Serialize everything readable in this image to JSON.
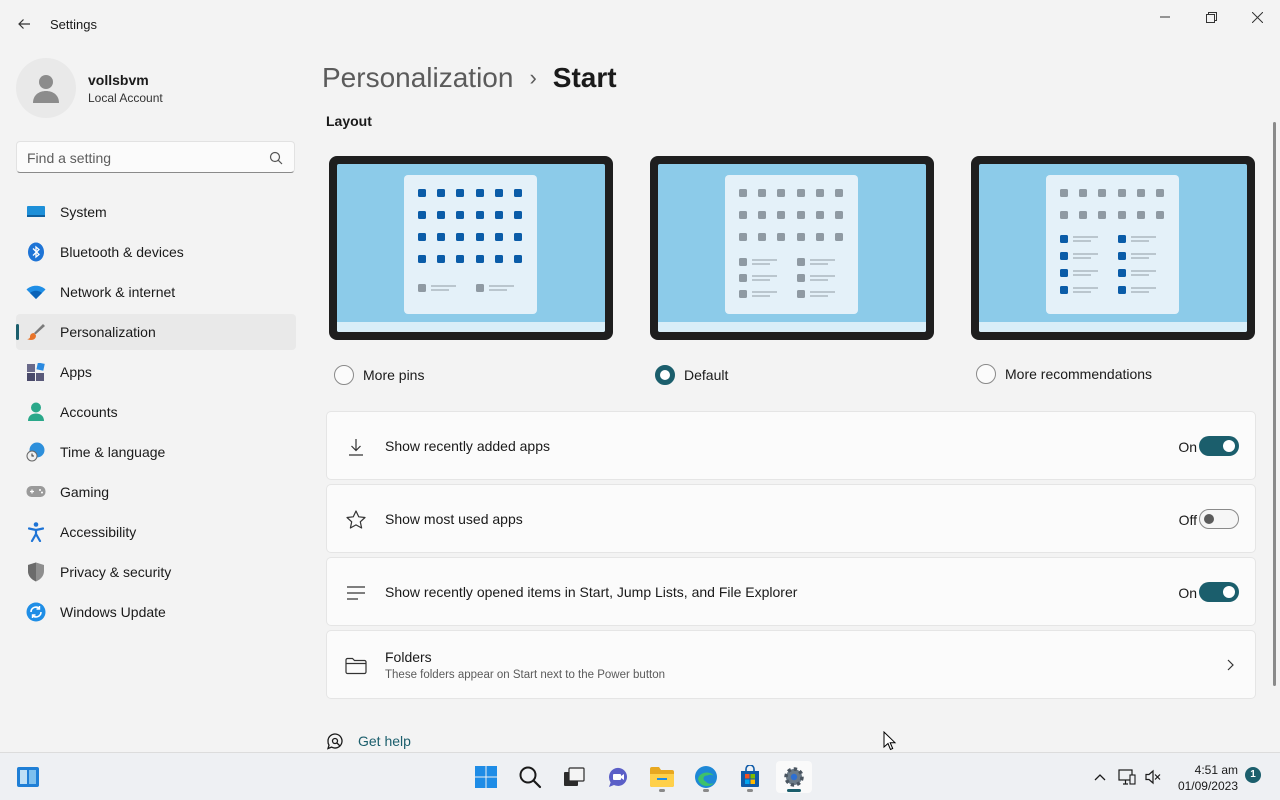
{
  "window": {
    "app_title": "Settings",
    "icons": {
      "back": "back-arrow-icon",
      "minimize": "minimize-icon",
      "maximize": "restore-icon",
      "close": "close-icon"
    }
  },
  "profile": {
    "name": "vollsbvm",
    "account_type": "Local Account"
  },
  "search": {
    "placeholder": "Find a setting",
    "value": ""
  },
  "sidebar": {
    "items": [
      {
        "label": "System",
        "icon": "system-icon",
        "active": false
      },
      {
        "label": "Bluetooth & devices",
        "icon": "bluetooth-icon",
        "active": false
      },
      {
        "label": "Network & internet",
        "icon": "wifi-icon",
        "active": false
      },
      {
        "label": "Personalization",
        "icon": "brush-icon",
        "active": true
      },
      {
        "label": "Apps",
        "icon": "apps-icon",
        "active": false
      },
      {
        "label": "Accounts",
        "icon": "accounts-icon",
        "active": false
      },
      {
        "label": "Time & language",
        "icon": "globe-clock-icon",
        "active": false
      },
      {
        "label": "Gaming",
        "icon": "gamepad-icon",
        "active": false
      },
      {
        "label": "Accessibility",
        "icon": "accessibility-icon",
        "active": false
      },
      {
        "label": "Privacy & security",
        "icon": "shield-icon",
        "active": false
      },
      {
        "label": "Windows Update",
        "icon": "update-icon",
        "active": false
      }
    ]
  },
  "breadcrumb": {
    "parent": "Personalization",
    "separator": "›",
    "current": "Start"
  },
  "layout": {
    "title": "Layout",
    "options": [
      {
        "label": "More pins",
        "selected": false
      },
      {
        "label": "Default",
        "selected": true
      },
      {
        "label": "More recommendations",
        "selected": false
      }
    ]
  },
  "settings": [
    {
      "label": "Show recently added apps",
      "state": "On",
      "icon": "download-icon"
    },
    {
      "label": "Show most used apps",
      "state": "Off",
      "icon": "star-icon"
    },
    {
      "label": "Show recently opened items in Start, Jump Lists, and File Explorer",
      "state": "On",
      "icon": "list-icon"
    }
  ],
  "folders": {
    "title": "Folders",
    "description": "These folders appear on Start next to the Power button",
    "icon": "folder-icon"
  },
  "help": {
    "label": "Get help"
  },
  "taskbar": {
    "apps": [
      "start-icon",
      "search-icon",
      "task-view-icon",
      "chat-icon",
      "file-explorer-icon",
      "edge-icon",
      "store-icon",
      "settings-icon"
    ],
    "time": "4:51 am",
    "date": "01/09/2023",
    "notification_count": "1"
  },
  "colors": {
    "accent": "#1b5e6c",
    "background": "#f3f3f3",
    "card": "#fbfbfb"
  }
}
